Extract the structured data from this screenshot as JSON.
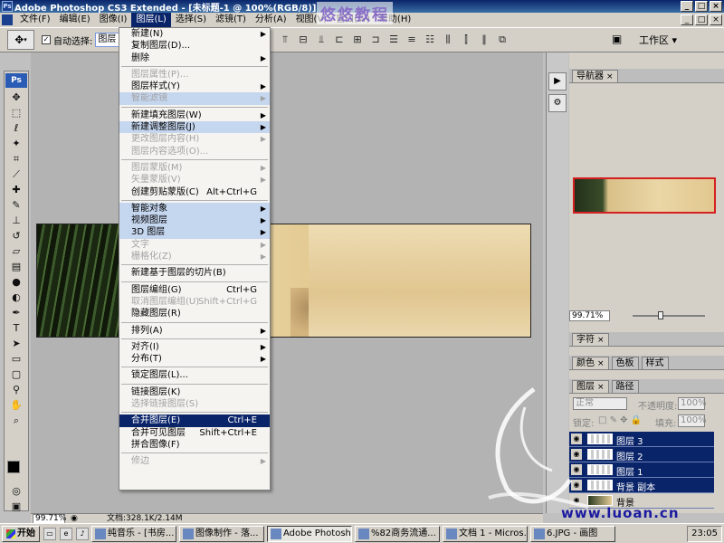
{
  "window": {
    "title": "Adobe Photoshop CS3 Extended - [未标题-1 @ 100%(RGB/8)]",
    "ps_icon": "Ps"
  },
  "watermark_top": "悠悠教程",
  "watermark_bottom": "www.luoan.cn",
  "menubar": {
    "items": [
      "文件(F)",
      "编辑(E)",
      "图像(I)",
      "图层(L)",
      "选择(S)",
      "滤镜(T)",
      "分析(A)",
      "视图(V)",
      "窗口(W)",
      "帮助(H)"
    ],
    "active_index": 3
  },
  "options": {
    "auto_select_label": "自动选择:",
    "auto_select_value": "图层",
    "workspace_label": "工作区 ▾"
  },
  "toolbox": {
    "logo": "Ps",
    "tools": [
      "move-tool",
      "marquee-tool",
      "lasso-tool",
      "magic-wand-tool",
      "crop-tool",
      "slice-tool",
      "healing-tool",
      "brush-tool",
      "stamp-tool",
      "history-brush-tool",
      "eraser-tool",
      "gradient-tool",
      "blur-tool",
      "dodge-tool",
      "pen-tool",
      "type-tool",
      "path-select-tool",
      "shape-tool",
      "notes-tool",
      "eyedropper-tool",
      "hand-tool",
      "zoom-tool"
    ]
  },
  "layer_menu": {
    "items": [
      {
        "label": "新建(N)",
        "arrow": true
      },
      {
        "label": "复制图层(D)..."
      },
      {
        "label": "删除",
        "arrow": true
      },
      {
        "sep": true
      },
      {
        "label": "图层属性(P)...",
        "disabled": true
      },
      {
        "label": "图层样式(Y)",
        "arrow": true
      },
      {
        "label": "智能滤镜",
        "disabled": true,
        "highlight": true,
        "arrow": true
      },
      {
        "sep": true
      },
      {
        "label": "新建填充图层(W)",
        "arrow": true
      },
      {
        "label": "新建调整图层(J)",
        "arrow": true,
        "highlight": true
      },
      {
        "label": "更改图层内容(H)",
        "disabled": true,
        "arrow": true
      },
      {
        "label": "图层内容选项(O)...",
        "disabled": true
      },
      {
        "sep": true
      },
      {
        "label": "图层蒙版(M)",
        "disabled": true,
        "arrow": true
      },
      {
        "label": "矢量蒙版(V)",
        "disabled": true,
        "arrow": true
      },
      {
        "label": "创建剪贴蒙版(C)",
        "shortcut": "Alt+Ctrl+G"
      },
      {
        "sep": true
      },
      {
        "label": "智能对象",
        "arrow": true,
        "highlight": true
      },
      {
        "label": "视频图层",
        "arrow": true,
        "highlight": true
      },
      {
        "label": "3D 图层",
        "arrow": true,
        "highlight": true
      },
      {
        "label": "文字",
        "disabled": true,
        "arrow": true
      },
      {
        "label": "栅格化(Z)",
        "disabled": true,
        "arrow": true
      },
      {
        "sep": true
      },
      {
        "label": "新建基于图层的切片(B)"
      },
      {
        "sep": true
      },
      {
        "label": "图层编组(G)",
        "shortcut": "Ctrl+G"
      },
      {
        "label": "取消图层编组(U)",
        "shortcut": "Shift+Ctrl+G",
        "disabled": true
      },
      {
        "label": "隐藏图层(R)"
      },
      {
        "sep": true
      },
      {
        "label": "排列(A)",
        "arrow": true
      },
      {
        "sep": true
      },
      {
        "label": "对齐(I)",
        "arrow": true
      },
      {
        "label": "分布(T)",
        "arrow": true
      },
      {
        "sep": true
      },
      {
        "label": "锁定图层(L)..."
      },
      {
        "sep": true
      },
      {
        "label": "链接图层(K)"
      },
      {
        "label": "选择链接图层(S)",
        "disabled": true
      },
      {
        "sep": true
      },
      {
        "label": "合并图层(E)",
        "shortcut": "Ctrl+E",
        "selected": true
      },
      {
        "label": "合并可见图层",
        "shortcut": "Shift+Ctrl+E"
      },
      {
        "label": "拼合图像(F)"
      },
      {
        "sep": true
      },
      {
        "label": "修边",
        "disabled": true,
        "arrow": true
      }
    ]
  },
  "panels": {
    "navigator_tab": "导航器",
    "navigator_zoom": "99.71%",
    "character_tab": "字符",
    "color_tabs": [
      "颜色",
      "色板",
      "样式"
    ],
    "layers_tabs": [
      "图层",
      "路径"
    ],
    "blend_mode": "正常",
    "opacity_label": "不透明度:",
    "opacity_value": "100%",
    "lock_label": "锁定:",
    "fill_label": "填充:",
    "fill_value": "100%",
    "layers": [
      {
        "name": "图层 3"
      },
      {
        "name": "图层 2"
      },
      {
        "name": "图层 1"
      },
      {
        "name": "背景 副本"
      },
      {
        "name": "背景"
      }
    ]
  },
  "status": {
    "zoom": "99.71%",
    "doc": "文档:328.1K/2.14M"
  },
  "taskbar": {
    "start": "开始",
    "tasks": [
      "纯音乐 - [书房...",
      "图像制作 - 落...",
      "Adobe Photosh...",
      "%82商务流通...",
      "文档 1 - Micros...",
      "6.JPG - 画图"
    ],
    "active_index": 2,
    "clock": "23:05"
  }
}
